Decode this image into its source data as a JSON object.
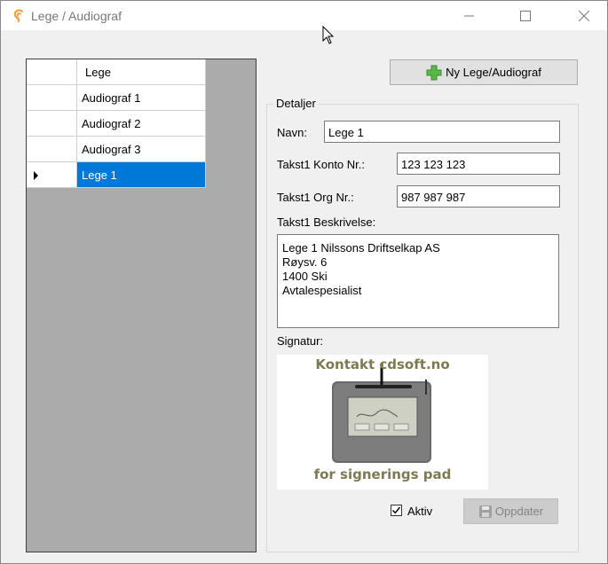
{
  "window": {
    "title": "Lege / Audiograf"
  },
  "grid": {
    "header": "Lege",
    "rows": [
      {
        "name": "Audiograf 1"
      },
      {
        "name": "Audiograf 2"
      },
      {
        "name": "Audiograf 3"
      },
      {
        "name": "Lege 1",
        "selected": true
      }
    ]
  },
  "toolbar": {
    "new_label": "Ny Lege/Audiograf"
  },
  "details": {
    "group_label": "Detaljer",
    "navn_label": "Navn:",
    "navn_value": "Lege 1",
    "konto_label": "Takst1 Konto Nr.:",
    "konto_value": "123 123 123",
    "org_label": "Takst1 Org Nr.:",
    "org_value": "987 987 987",
    "beskrivelse_label": "Takst1 Beskrivelse:",
    "beskrivelse_lines": [
      "Lege 1 Nilssons Driftselkap AS",
      "Røysv. 6",
      "1400 Ski",
      "Avtalespesialist"
    ],
    "signatur_label": "Signatur:",
    "signature_top_text": "Kontakt cdsoft.no",
    "signature_bottom_text": "for signerings pad",
    "aktiv_label": "Aktiv",
    "aktiv_checked": true,
    "oppdater_label": "Oppdater"
  },
  "icons": [
    "app-ear-icon",
    "minimize-icon",
    "maximize-icon",
    "close-icon",
    "plus-icon",
    "save-icon",
    "check-icon",
    "cursor-icon",
    "row-selector-icon"
  ],
  "colors": {
    "selection": "#0078d7",
    "grid_bg": "#ababab",
    "window_bg": "#f0f0f0",
    "plus_green": "#58b947"
  }
}
